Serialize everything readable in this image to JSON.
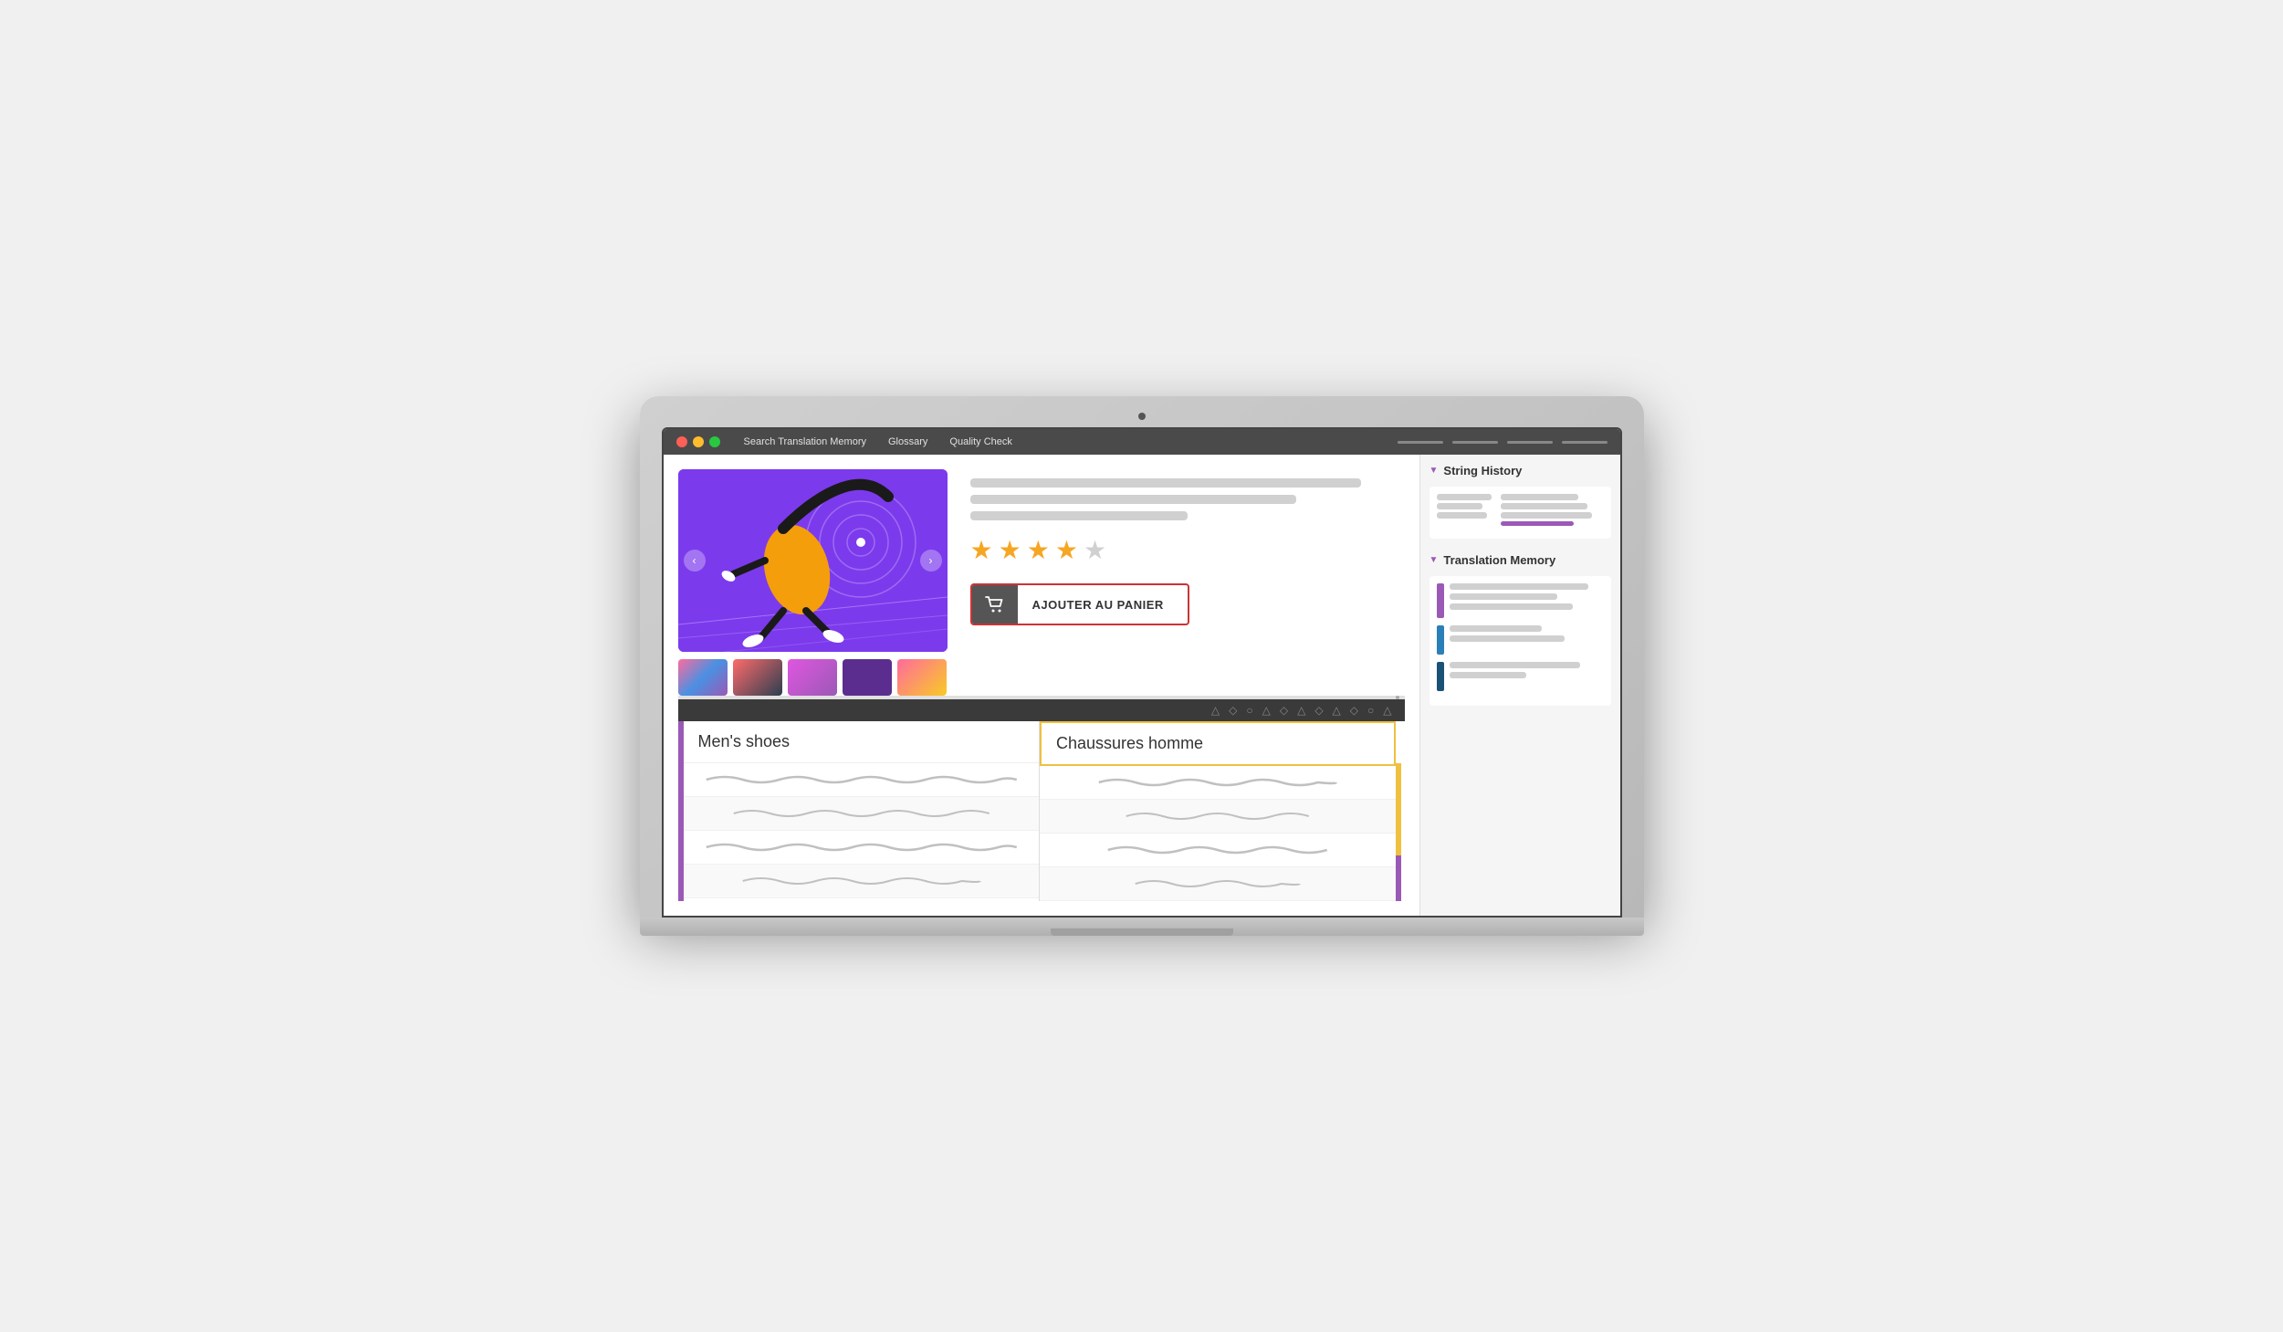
{
  "laptop": {
    "camera_label": "camera"
  },
  "titlebar": {
    "nav_items": [
      {
        "label": "Search Translation Memory",
        "id": "search-tm"
      },
      {
        "label": "Glossary",
        "id": "glossary"
      },
      {
        "label": "Quality Check",
        "id": "quality-check"
      }
    ]
  },
  "product": {
    "stars": [
      {
        "filled": true
      },
      {
        "filled": true
      },
      {
        "filled": true
      },
      {
        "filled": true
      },
      {
        "filled": false
      }
    ],
    "add_to_cart_label": "AJOUTER AU PANIER"
  },
  "sidebar": {
    "string_history_title": "String History",
    "translation_memory_title": "Translation Memory"
  },
  "toolbar": {
    "icons": [
      "△",
      "◇",
      "○",
      "△",
      "◇",
      "△",
      "◇",
      "△",
      "◇",
      "○",
      "△"
    ]
  },
  "translation_table": {
    "left_header": "Men's shoes",
    "right_header": "Chaussures homme"
  }
}
